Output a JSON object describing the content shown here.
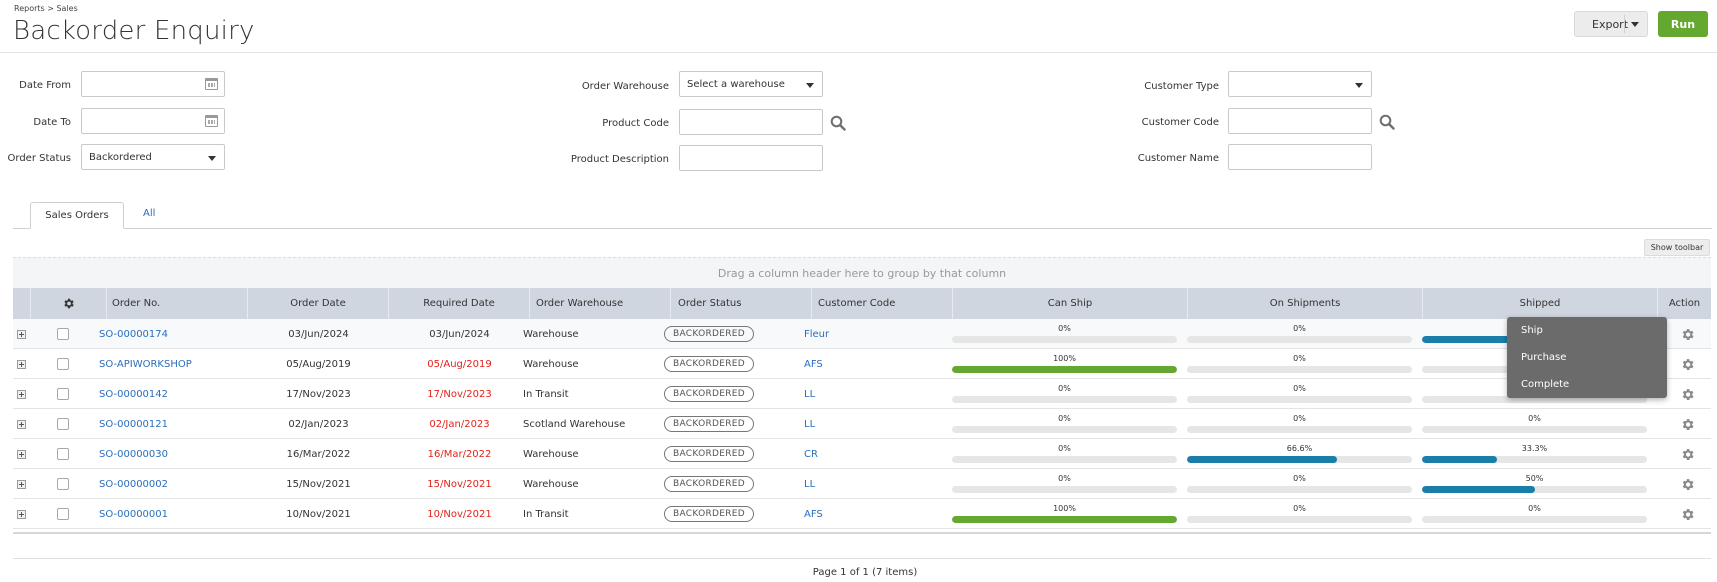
{
  "breadcrumb": "Reports > Sales",
  "title": "Backorder Enquiry",
  "toolbar": {
    "export_label": "Export",
    "run_label": "Run"
  },
  "filters": {
    "date_from_label": "Date From",
    "date_to_label": "Date To",
    "order_status_label": "Order Status",
    "order_status_value": "Backordered",
    "order_warehouse_label": "Order Warehouse",
    "order_warehouse_value": "Select a warehouse",
    "product_code_label": "Product Code",
    "product_description_label": "Product Description",
    "customer_type_label": "Customer Type",
    "customer_code_label": "Customer Code",
    "customer_name_label": "Customer Name"
  },
  "tabs": {
    "sales_orders": "Sales Orders",
    "all": "All"
  },
  "grid": {
    "show_toolbar_label": "Show toolbar",
    "group_hint": "Drag a column header here to group by that column",
    "columns": {
      "order_no": "Order No.",
      "order_date": "Order Date",
      "required_date": "Required Date",
      "order_warehouse": "Order Warehouse",
      "order_status": "Order Status",
      "customer_code": "Customer Code",
      "can_ship": "Can Ship",
      "on_shipments": "On Shipments",
      "shipped": "Shipped",
      "action": "Action"
    },
    "rows": [
      {
        "order_no": "SO-00000174",
        "order_date": "03/Jun/2024",
        "required_date": "03/Jun/2024",
        "required_overdue": false,
        "warehouse": "Warehouse",
        "status": "BACKORDERED",
        "customer": "Fleur",
        "can_ship": "0%",
        "can_ship_pct": 0,
        "on_shipments": "0%",
        "on_shipments_pct": 0,
        "shipped": "",
        "shipped_pct": 45
      },
      {
        "order_no": "SO-APIWORKSHOP",
        "order_date": "05/Aug/2019",
        "required_date": "05/Aug/2019",
        "required_overdue": true,
        "warehouse": "Warehouse",
        "status": "BACKORDERED",
        "customer": "AFS",
        "can_ship": "100%",
        "can_ship_pct": 100,
        "on_shipments": "0%",
        "on_shipments_pct": 0,
        "shipped": "",
        "shipped_pct": 0
      },
      {
        "order_no": "SO-00000142",
        "order_date": "17/Nov/2023",
        "required_date": "17/Nov/2023",
        "required_overdue": true,
        "warehouse": "In Transit",
        "status": "BACKORDERED",
        "customer": "LL",
        "can_ship": "0%",
        "can_ship_pct": 0,
        "on_shipments": "0%",
        "on_shipments_pct": 0,
        "shipped": "",
        "shipped_pct": 0
      },
      {
        "order_no": "SO-00000121",
        "order_date": "02/Jan/2023",
        "required_date": "02/Jan/2023",
        "required_overdue": true,
        "warehouse": "Scotland Warehouse",
        "status": "BACKORDERED",
        "customer": "LL",
        "can_ship": "0%",
        "can_ship_pct": 0,
        "on_shipments": "0%",
        "on_shipments_pct": 0,
        "shipped": "0%",
        "shipped_pct": 0
      },
      {
        "order_no": "SO-00000030",
        "order_date": "16/Mar/2022",
        "required_date": "16/Mar/2022",
        "required_overdue": true,
        "warehouse": "Warehouse",
        "status": "BACKORDERED",
        "customer": "CR",
        "can_ship": "0%",
        "can_ship_pct": 0,
        "on_shipments": "66.6%",
        "on_shipments_pct": 66.6,
        "shipped": "33.3%",
        "shipped_pct": 33.3
      },
      {
        "order_no": "SO-00000002",
        "order_date": "15/Nov/2021",
        "required_date": "15/Nov/2021",
        "required_overdue": true,
        "warehouse": "Warehouse",
        "status": "BACKORDERED",
        "customer": "LL",
        "can_ship": "0%",
        "can_ship_pct": 0,
        "on_shipments": "0%",
        "on_shipments_pct": 0,
        "shipped": "50%",
        "shipped_pct": 50
      },
      {
        "order_no": "SO-00000001",
        "order_date": "10/Nov/2021",
        "required_date": "10/Nov/2021",
        "required_overdue": true,
        "warehouse": "In Transit",
        "status": "BACKORDERED",
        "customer": "AFS",
        "can_ship": "100%",
        "can_ship_pct": 100,
        "on_shipments": "0%",
        "on_shipments_pct": 0,
        "shipped": "0%",
        "shipped_pct": 0
      }
    ]
  },
  "action_menu": {
    "items": [
      "Ship",
      "Purchase",
      "Complete"
    ]
  },
  "pager": "Page 1 of 1 (7 items)",
  "colors": {
    "run_green": "#65a830",
    "progress_green": "#65a830",
    "progress_blue": "#1a7ea8",
    "link_blue": "#2a6ebb",
    "overdue_red": "#e2231a",
    "header_grey": "#cfd6df",
    "menu_grey": "#6b6b6b"
  }
}
